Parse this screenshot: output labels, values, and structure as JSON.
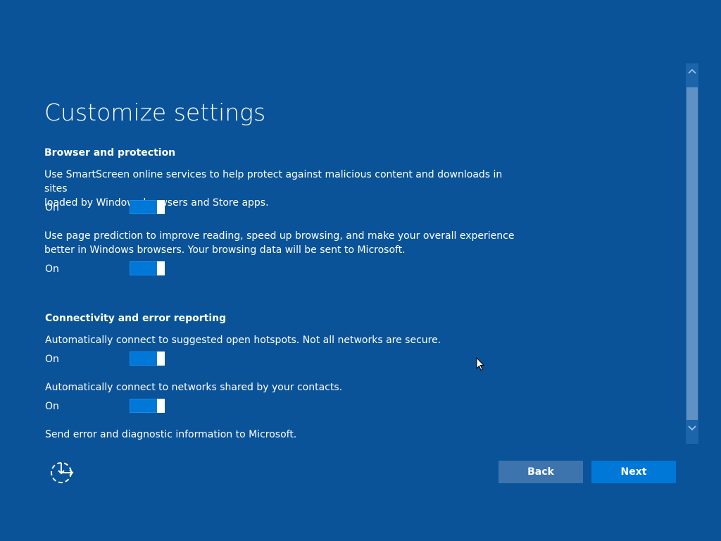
{
  "page": {
    "title": "Customize settings"
  },
  "sections": [
    {
      "heading": "Browser and protection",
      "settings": [
        {
          "description_line1": "Use SmartScreen online services to help protect against malicious content and downloads in sites",
          "description_line2": "loaded by Windows browsers and Store apps.",
          "state": "On"
        },
        {
          "description_line1": "Use page prediction to improve reading, speed up browsing, and make your overall experience",
          "description_line2": "better in Windows browsers. Your browsing data will be sent to Microsoft.",
          "state": "On"
        }
      ]
    },
    {
      "heading": "Connectivity and error reporting",
      "settings": [
        {
          "description_line1": "Automatically connect to suggested open hotspots. Not all networks are secure.",
          "state": "On"
        },
        {
          "description_line1": "Automatically connect to networks shared by your contacts.",
          "state": "On"
        },
        {
          "description_line1": "Send error and diagnostic information to Microsoft."
        }
      ]
    }
  ],
  "buttons": {
    "back": "Back",
    "next": "Next"
  },
  "icons": {
    "ease_of_access": "ease-of-access-icon",
    "scroll_up": "chevron-up-icon",
    "scroll_down": "chevron-down-icon",
    "cursor": "mouse-pointer-icon"
  },
  "colors": {
    "background": "#0a5399",
    "accent": "#0078d7",
    "back_button": "#3d74ad",
    "text": "#ffffff"
  }
}
